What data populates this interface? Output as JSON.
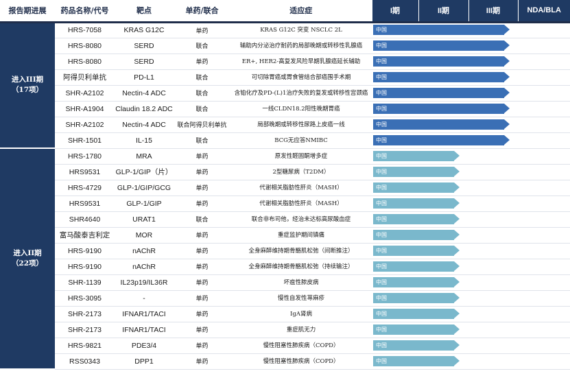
{
  "headers": {
    "stage": "报告期进展",
    "drug": "药品名称/代号",
    "target": "靶点",
    "mono": "单药/联合",
    "indication": "适应症",
    "p1": "I期",
    "p2": "II期",
    "p3": "III期",
    "nda": "NDA/BLA"
  },
  "colors": {
    "phase3_bar": "#3a6fb5",
    "phase1_bar": "#7ab8cc",
    "header_navy": "#1f3a63"
  },
  "groups": [
    {
      "label_line1": "进入III期",
      "label_line2": "（17项）",
      "bar_color": "#3a6fb5",
      "bar_progress_phases": 2.8,
      "rows": [
        {
          "drug": "HRS-7058",
          "target": "KRAS G12C",
          "mono": "单药",
          "indication": "KRAS G12C 突变 NSCLC 2L",
          "bar_label": "中国"
        },
        {
          "drug": "HRS-8080",
          "target": "SERD",
          "mono": "联合",
          "indication": "辅助内分泌治疗耐药的局部晚期或转移性乳腺癌",
          "bar_label": "中国"
        },
        {
          "drug": "HRS-8080",
          "target": "SERD",
          "mono": "单药",
          "indication": "ER+, HER2-高复发风险早期乳腺癌延长辅助",
          "bar_label": "中国"
        },
        {
          "drug": "阿得贝利单抗",
          "target": "PD-L1",
          "mono": "联合",
          "indication": "可切除胃癌或胃食管结合部癌围手术期",
          "bar_label": "中国"
        },
        {
          "drug": "SHR-A2102",
          "target": "Nectin-4 ADC",
          "mono": "联合",
          "indication": "含铂化疗及PD-(L)1治疗失败的复发或转移性宫颈癌",
          "bar_label": "中国"
        },
        {
          "drug": "SHR-A1904",
          "target": "Claudin 18.2 ADC",
          "mono": "联合",
          "indication": "一线CLDN18.2阳性晚期胃癌",
          "bar_label": "中国"
        },
        {
          "drug": "SHR-A2102",
          "target": "Nectin-4 ADC",
          "mono": "联合阿得贝利单抗",
          "indication": "局部晚期或转移性尿路上皮癌一线",
          "bar_label": "中国"
        },
        {
          "drug": "SHR-1501",
          "target": "IL-15",
          "mono": "联合",
          "indication": "BCG无应答NMIBC",
          "bar_label": "中国"
        }
      ]
    },
    {
      "label_line1": "进入II期",
      "label_line2": "（22项）",
      "bar_color": "#7ab8cc",
      "bar_progress_phases": 1.8,
      "rows": [
        {
          "drug": "HRS-1780",
          "target": "MRA",
          "mono": "单药",
          "indication": "原发性醛固酮增多症",
          "bar_label": "中国"
        },
        {
          "drug": "HRS9531",
          "target": "GLP-1/GIP（片）",
          "mono": "单药",
          "indication": "2型糖尿病（T2DM）",
          "bar_label": "中国"
        },
        {
          "drug": "HRS-4729",
          "target": "GLP-1/GIP/GCG",
          "mono": "单药",
          "indication": "代谢相关脂肪性肝炎（MASH）",
          "bar_label": "中国"
        },
        {
          "drug": "HRS9531",
          "target": "GLP-1/GIP",
          "mono": "单药",
          "indication": "代谢相关脂肪性肝炎（MASH）",
          "bar_label": "中国"
        },
        {
          "drug": "SHR4640",
          "target": "URAT1",
          "mono": "联合",
          "indication": "联合非布司他，经治未达标高尿酸血症",
          "bar_label": "中国"
        },
        {
          "drug": "富马酸泰吉利定",
          "target": "MOR",
          "mono": "单药",
          "indication": "重症监护期间镇痛",
          "bar_label": "中国"
        },
        {
          "drug": "HRS-9190",
          "target": "nAChR",
          "mono": "单药",
          "indication": "全身麻醉维持期骨骼肌松弛（间断推注）",
          "bar_label": "中国"
        },
        {
          "drug": "HRS-9190",
          "target": "nAChR",
          "mono": "单药",
          "indication": "全身麻醉维持期骨骼肌松弛（持续输注）",
          "bar_label": "中国"
        },
        {
          "drug": "SHR-1139",
          "target": "IL23p19/IL36R",
          "mono": "单药",
          "indication": "坏疽性脓皮病",
          "bar_label": "中国"
        },
        {
          "drug": "HRS-3095",
          "target": "-",
          "mono": "单药",
          "indication": "慢性自发性荨麻疹",
          "bar_label": "中国"
        },
        {
          "drug": "SHR-2173",
          "target": "IFNAR1/TACI",
          "mono": "单药",
          "indication": "IgA肾病",
          "bar_label": "中国"
        },
        {
          "drug": "SHR-2173",
          "target": "IFNAR1/TACI",
          "mono": "单药",
          "indication": "重症肌无力",
          "bar_label": "中国"
        },
        {
          "drug": "HRS-9821",
          "target": "PDE3/4",
          "mono": "单药",
          "indication": "慢性阻塞性肺疾病（COPD）",
          "bar_label": "中国"
        },
        {
          "drug": "RSS0343",
          "target": "DPP1",
          "mono": "单药",
          "indication": "慢性阻塞性肺疾病（COPD）",
          "bar_label": "中国"
        }
      ]
    }
  ]
}
